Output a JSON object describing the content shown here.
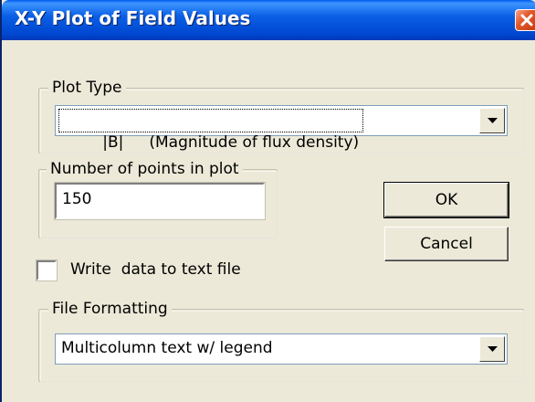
{
  "window": {
    "title": "X-Y Plot of Field Values",
    "close_icon": "close-x-icon",
    "title_bar_color": "#0a5fe6",
    "close_color": "#e25a2e",
    "background": "#ece9d8"
  },
  "plot_type": {
    "legend": "Plot Type",
    "selected_code": "|B|",
    "selected_desc": "(Magnitude of flux density)",
    "arrow_icon": "chevron-down-icon"
  },
  "points": {
    "legend": "Number of points in plot",
    "value": "150"
  },
  "buttons": {
    "ok_label": "OK",
    "cancel_label": "Cancel"
  },
  "write_to_file": {
    "label": "Write  data to text file",
    "checked": false
  },
  "file_formatting": {
    "legend": "File Formatting",
    "selected": "Multicolumn text w/ legend",
    "arrow_icon": "chevron-down-icon"
  }
}
